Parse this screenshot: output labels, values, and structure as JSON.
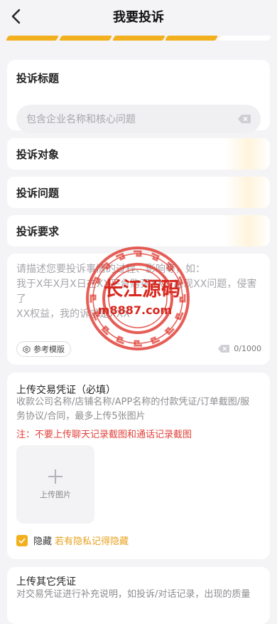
{
  "header": {
    "title": "我要投诉",
    "back_icon": "chevron-left-icon"
  },
  "progress": {
    "completed_steps": 4,
    "total_steps": 5,
    "accent": "#f2b01e",
    "inactive": "#ffffff"
  },
  "complaint_title": {
    "label": "投诉标题",
    "placeholder": "包含企业名称和核心问题",
    "clear_icon": "clear-icon"
  },
  "rows": [
    {
      "label": "投诉对象"
    },
    {
      "label": "投诉问题"
    },
    {
      "label": "投诉要求"
    }
  ],
  "description": {
    "placeholder_lines": [
      "请描述您要投诉事情的过程、影响等，如：",
      "我于X年X月X日在XX平台购买XX，出现XX问题，侵害了",
      "XX权益，我的诉求是XXX"
    ],
    "template_button": "参考模版",
    "counter": "0/1000"
  },
  "upload_proof": {
    "title": "上传交易凭证（必填）",
    "desc_lines": [
      "收款公司名称/店铺名称/APP名称的付款凭证/订单截图/服",
      "务协议/合同，最多上传5张图片"
    ],
    "warning": "注：不要上传聊天记录截图和通话记录截图",
    "upload_label": "上传图片",
    "hide_label": "隐藏",
    "hide_hint": "若有隐私记得隐藏"
  },
  "other_proof": {
    "title": "上传其它凭证",
    "desc": "对交易凭证进行补充说明，如投诉/对话记录，出现的质量"
  },
  "watermark": {
    "text_main": "长江源码",
    "text_url": "m8887.com",
    "color": "#e03a31"
  }
}
